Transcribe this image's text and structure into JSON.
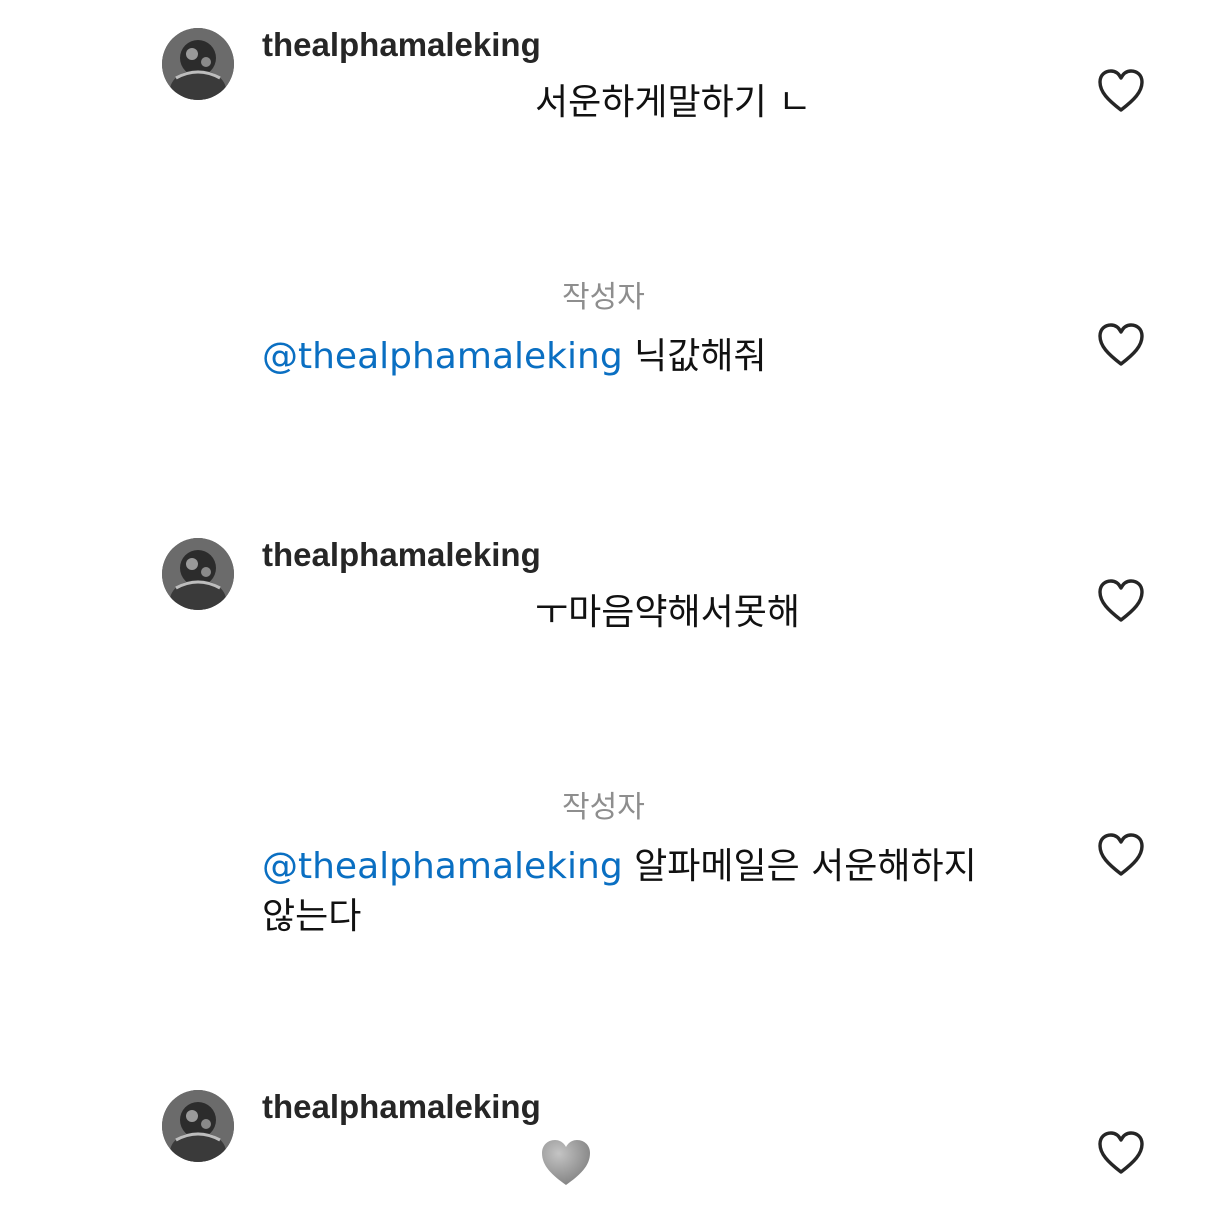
{
  "comments": [
    {
      "username": "thealphamaleking",
      "text": "서운하게말하기 ㄴ"
    },
    {
      "author_label": "작성자",
      "mention": "@thealphamaleking",
      "text": "닉값해줘"
    },
    {
      "username": "thealphamaleking",
      "text": "ㅜ마음약해서못해"
    },
    {
      "author_label": "작성자",
      "mention": "@thealphamaleking",
      "text_line1": "알파메일은 서운해하지",
      "text_line2": "않는다"
    },
    {
      "username": "thealphamaleking",
      "emoji": "grey-heart"
    }
  ],
  "colors": {
    "mention": "#0a6fc2",
    "author_label": "#8e8e8e",
    "username": "#262626",
    "like_outline": "#262626",
    "emoji_heart": "#9a9a9a"
  }
}
